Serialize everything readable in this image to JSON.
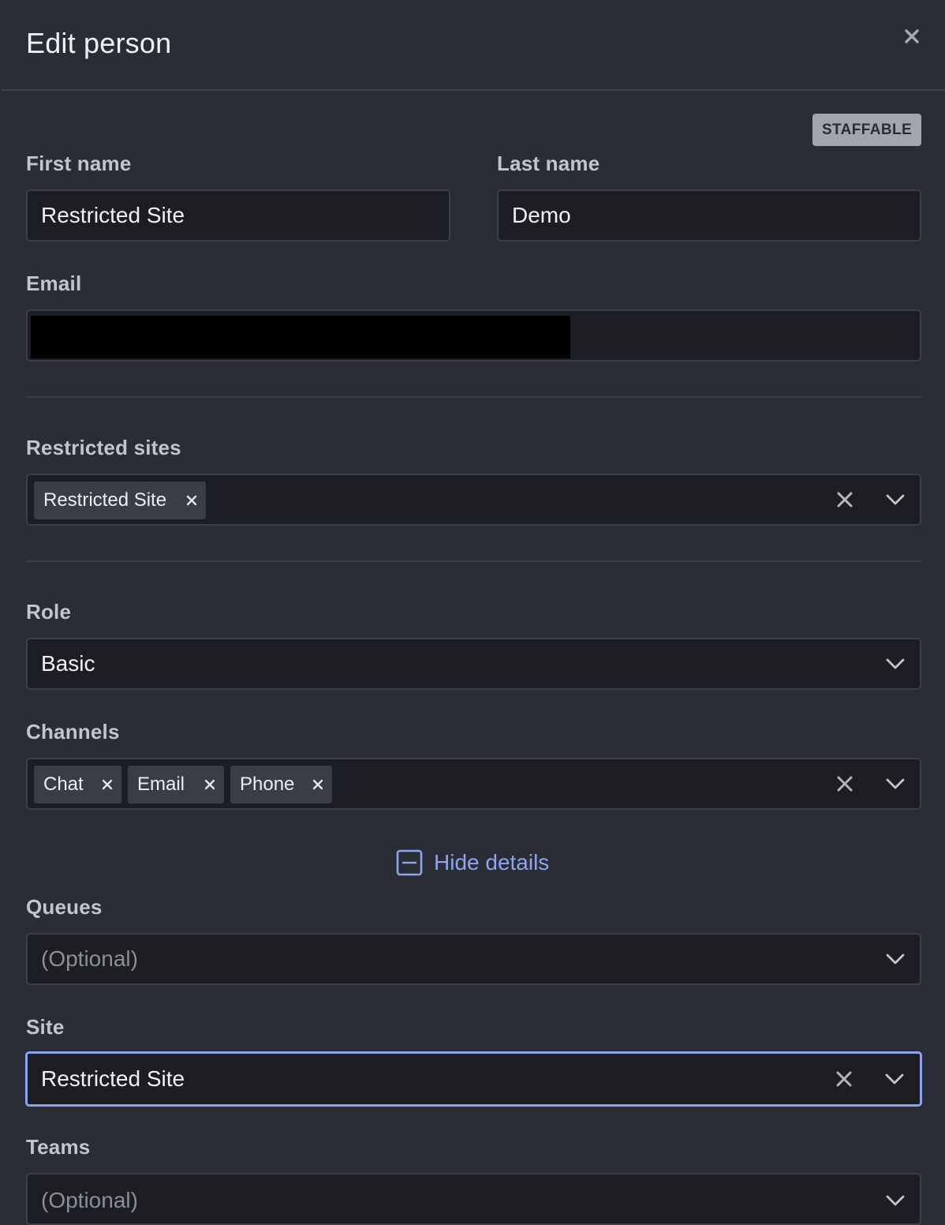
{
  "dialog": {
    "title": "Edit person",
    "close_icon": "close-icon",
    "badge": "STAFFABLE"
  },
  "form": {
    "first_name": {
      "label": "First name",
      "value": "Restricted Site"
    },
    "last_name": {
      "label": "Last name",
      "value": "Demo"
    },
    "email": {
      "label": "Email",
      "value_redacted": true
    },
    "restricted_sites": {
      "label": "Restricted sites",
      "chips": [
        "Restricted Site"
      ]
    },
    "role": {
      "label": "Role",
      "value": "Basic"
    },
    "channels": {
      "label": "Channels",
      "chips": [
        "Chat",
        "Email",
        "Phone"
      ]
    },
    "details_toggle": {
      "label": "Hide details",
      "icon": "minus-square-icon"
    },
    "queues": {
      "label": "Queues",
      "placeholder": "(Optional)"
    },
    "site": {
      "label": "Site",
      "value": "Restricted Site"
    },
    "teams": {
      "label": "Teams",
      "placeholder": "(Optional)"
    }
  },
  "colors": {
    "background": "#2b2d36",
    "input_bg": "#1d1e24",
    "accent": "#8fa3ef",
    "badge_bg": "#a3a5ac"
  }
}
